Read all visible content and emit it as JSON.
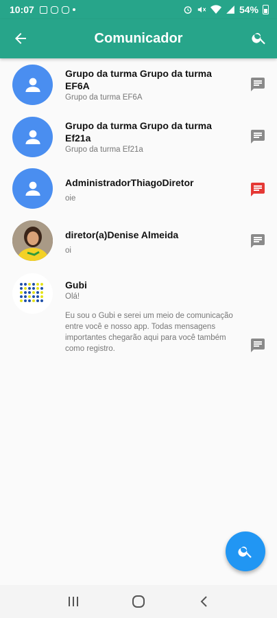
{
  "status_bar": {
    "time": "10:07",
    "battery": "54%"
  },
  "app_bar": {
    "title": "Comunicador"
  },
  "conversations": [
    {
      "name": "Grupo da turma Grupo da turma EF6A",
      "subtitle": "Grupo da turma EF6A",
      "message_icon_color": "#8a8a8a"
    },
    {
      "name": "Grupo da turma Grupo da turma Ef21a",
      "subtitle": "Grupo da turma Ef21a",
      "message_icon_color": "#8a8a8a"
    },
    {
      "name": "AdministradorThiagoDiretor",
      "subtitle": "oie",
      "message_icon_color": "#e53935"
    },
    {
      "name": "diretor(a)Denise Almeida",
      "subtitle": "oi",
      "message_icon_color": "#8a8a8a"
    },
    {
      "name": "Gubi",
      "subtitle": "Olá!",
      "description": "Eu sou o Gubi e serei um meio de comunicação entre você e nosso app. Todas mensagens importantes chegarão aqui para você também como registro.",
      "message_icon_color": "#8a8a8a"
    }
  ],
  "colors": {
    "primary": "#27a58a",
    "fab": "#2196f3",
    "avatar_default": "#4a8ef0",
    "unread": "#e53935"
  },
  "icons": {
    "back": "arrow-left-icon",
    "search": "search-icon",
    "message": "message-icon",
    "fab": "search-icon"
  }
}
